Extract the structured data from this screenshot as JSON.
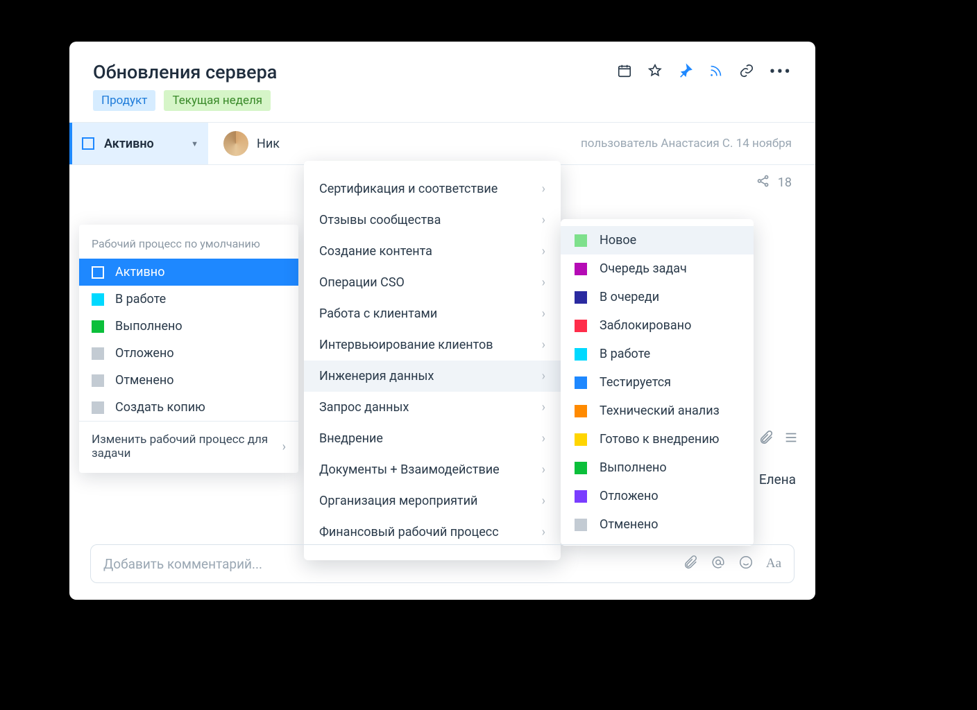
{
  "header": {
    "title": "Обновления сервера",
    "tags": [
      {
        "label": "Продукт",
        "class": "blue"
      },
      {
        "label": "Текущая неделя",
        "class": "green"
      }
    ]
  },
  "status_row": {
    "label": "Активно",
    "assignee_partial": "Ник",
    "meta": "пользователь Анастасия С. 14 ноября"
  },
  "share": {
    "count": "18"
  },
  "sidepanel": {
    "heading": "Рабочий процесс по умолчанию",
    "items": [
      {
        "label": "Активно",
        "color": "outline",
        "active": true
      },
      {
        "label": "В работе",
        "color": "cyan"
      },
      {
        "label": "Выполнено",
        "color": "green"
      },
      {
        "label": "Отложено",
        "color": "gray"
      },
      {
        "label": "Отменено",
        "color": "gray"
      },
      {
        "label": "Создать копию",
        "color": "gray"
      }
    ],
    "footer": "Изменить рабочий процесс для задачи"
  },
  "workflow_menu": [
    {
      "label": "Сертификация и соответствие"
    },
    {
      "label": "Отзывы сообщества"
    },
    {
      "label": "Создание контента"
    },
    {
      "label": "Операции CSO"
    },
    {
      "label": "Работа с клиентами"
    },
    {
      "label": "Интервьюирование клиентов"
    },
    {
      "label": "Инженерия данных",
      "hov": true
    },
    {
      "label": "Запрос данных"
    },
    {
      "label": "Внедрение"
    },
    {
      "label": "Документы + Взаимодействие"
    },
    {
      "label": "Организация мероприятий"
    },
    {
      "label": "Финансовый рабочий процесс"
    }
  ],
  "status_menu": [
    {
      "label": "Новое",
      "color": "#7ee08c",
      "hov": true
    },
    {
      "label": "Очередь задач",
      "color": "#b50bb5"
    },
    {
      "label": "В очереди",
      "color": "#2a2aa0"
    },
    {
      "label": "Заблокировано",
      "color": "#ff2d4a"
    },
    {
      "label": "В работе",
      "color": "#00d9ff"
    },
    {
      "label": "Тестируется",
      "color": "#1e88ff"
    },
    {
      "label": "Технический анализ",
      "color": "#ff8a00"
    },
    {
      "label": "Готово к внедрению",
      "color": "#ffd500"
    },
    {
      "label": "Выполнено",
      "color": "#0bbf3a"
    },
    {
      "label": "Отложено",
      "color": "#7a3dff"
    },
    {
      "label": "Отменено",
      "color": "#c3cbd3"
    }
  ],
  "detail": {
    "assignee2": "Елена"
  },
  "comment": {
    "placeholder": "Добавить комментарий..."
  }
}
